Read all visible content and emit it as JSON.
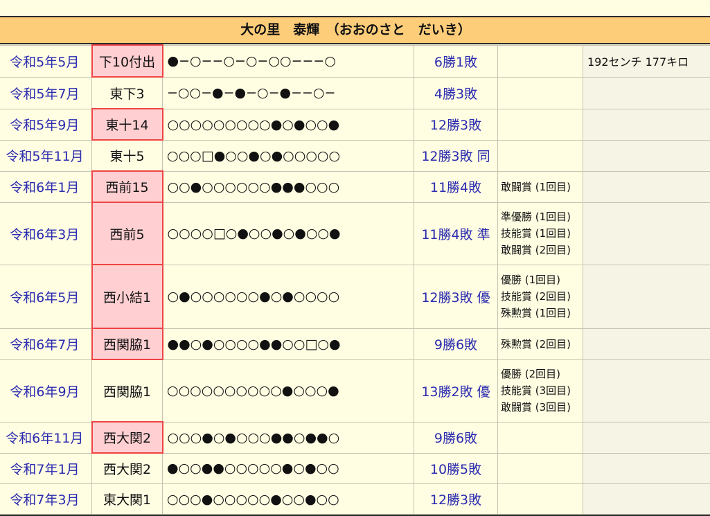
{
  "title": "大の里　泰輝　（おおのさと　だいき）",
  "rows": [
    {
      "period": "令和5年5月",
      "rank": "下10付出",
      "highlight": true,
      "bouts": "●−○−−○−○−○○−−−○",
      "record": "6勝1敗",
      "awards": "",
      "extra": "192センチ 177キロ"
    },
    {
      "period": "令和5年7月",
      "rank": "東下3",
      "highlight": false,
      "bouts": "−○○−●−●−○−●−−○−",
      "record": "4勝3敗",
      "awards": "",
      "extra": ""
    },
    {
      "period": "令和5年9月",
      "rank": "東十14",
      "highlight": true,
      "bouts": "○○○○○○○○○●○●○○●",
      "record": "12勝3敗",
      "awards": "",
      "extra": ""
    },
    {
      "period": "令和5年11月",
      "rank": "東十5",
      "highlight": false,
      "bouts": "○○○□●○○●○●○○○○○",
      "record": "12勝3敗 同",
      "awards": "",
      "extra": ""
    },
    {
      "period": "令和6年1月",
      "rank": "西前15",
      "highlight": true,
      "bouts": "○○●○○○○○○●●●○○○",
      "record": "11勝4敗",
      "awards": "敢闘賞 (1回目)",
      "extra": ""
    },
    {
      "period": "令和6年3月",
      "rank": "西前5",
      "highlight": true,
      "bouts": "○○○○□○●○○●○●○○●",
      "record": "11勝4敗 準",
      "awards": "準優勝 (1回目)\n技能賞 (1回目)\n敢闘賞 (2回目)",
      "extra": ""
    },
    {
      "period": "令和6年5月",
      "rank": "西小結1",
      "highlight": true,
      "bouts": "○●○○○○○○●○●○○○○",
      "record": "12勝3敗 優",
      "awards": "優勝 (1回目)\n技能賞 (2回目)\n殊勲賞 (1回目)",
      "extra": ""
    },
    {
      "period": "令和6年7月",
      "rank": "西関脇1",
      "highlight": true,
      "bouts": "●●○●○○○○●●○○□○●",
      "record": "9勝6敗",
      "awards": "殊勲賞 (2回目)",
      "extra": ""
    },
    {
      "period": "令和6年9月",
      "rank": "西関脇1",
      "highlight": false,
      "bouts": "○○○○○○○○○○●○○○●",
      "record": "13勝2敗 優",
      "awards": "優勝 (2回目)\n技能賞 (3回目)\n敢闘賞 (3回目)",
      "extra": ""
    },
    {
      "period": "令和6年11月",
      "rank": "西大関2",
      "highlight": true,
      "bouts": "○○○●○●○○○●●○●●○",
      "record": "9勝6敗",
      "awards": "",
      "extra": ""
    },
    {
      "period": "令和7年1月",
      "rank": "西大関2",
      "highlight": false,
      "bouts": "●○○●●○○○○○●○●○○",
      "record": "10勝5敗",
      "awards": "",
      "extra": ""
    },
    {
      "period": "令和7年3月",
      "rank": "東大関1",
      "highlight": false,
      "bouts": "○○○●○○○○○●○○●○○",
      "record": "12勝3敗",
      "awards": "",
      "extra": ""
    }
  ]
}
